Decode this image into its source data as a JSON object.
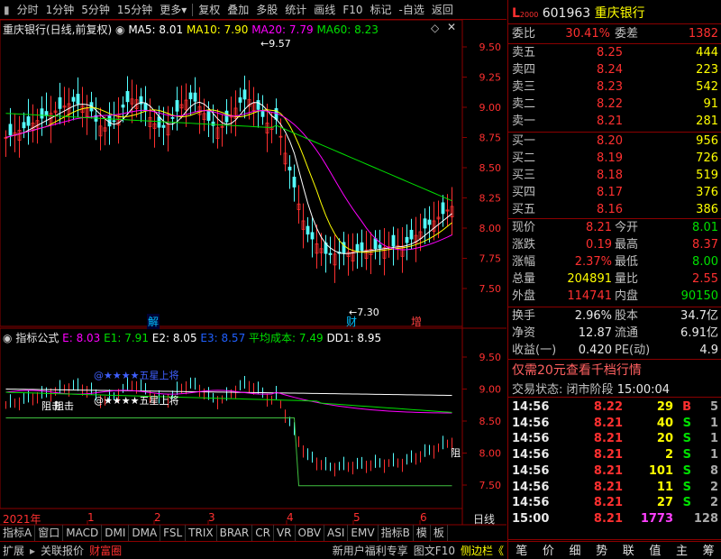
{
  "toolbar": {
    "period_items": [
      "分时",
      "1分钟",
      "5分钟",
      "15分钟",
      "更多"
    ],
    "items": [
      "复权",
      "叠加",
      "多股",
      "统计",
      "画线",
      "F10",
      "标记",
      "-自选",
      "返回"
    ]
  },
  "main_chart": {
    "title": "重庆银行(日线,前复权)",
    "ma5_label": "MA5: 8.01",
    "ma10_label": "MA10: 7.90",
    "ma20_label": "MA20: 7.79",
    "ma60_label": "MA60: 8.23",
    "high_annot": "9.57",
    "low_annot": "7.30",
    "y_ticks": [
      "9.50",
      "9.25",
      "9.00",
      "8.75",
      "8.50",
      "8.25",
      "8.00",
      "7.75",
      "7.50"
    ],
    "markers": [
      "解",
      "财",
      "增"
    ]
  },
  "indicator_chart": {
    "name": "指标公式",
    "e_label": "E: 8.03",
    "e1_label": "E1: 7.91",
    "e2_label": "E2: 8.05",
    "e3_label": "E3: 8.57",
    "avg_cost_label": "平均成本: 7.49",
    "dd1_label": "DD1: 8.95",
    "y_ticks": [
      "9.50",
      "9.00",
      "8.50",
      "8.00",
      "7.50"
    ],
    "annot_star1": "@★★★★五星上将",
    "annot_star2": "@★★★★五星上将",
    "annot_zuji1": "阻击",
    "annot_zuji2": "阻击",
    "annot_zu": "阻"
  },
  "x_axis": {
    "year": "2021年",
    "months": [
      "1",
      "2",
      "3",
      "4",
      "5",
      "6"
    ],
    "day_label": "日线"
  },
  "tabs": [
    "指标A",
    "窗口",
    "MACD",
    "DMI",
    "DMA",
    "FSL",
    "TRIX",
    "BRAR",
    "CR",
    "VR",
    "OBV",
    "ASI",
    "EMV",
    "指标B",
    "模",
    "板"
  ],
  "bottom": {
    "items": [
      "扩展",
      "关联报价",
      "财富圈"
    ],
    "promo": "新用户福利专享",
    "f10": "图文F10",
    "side": "侧边栏《"
  },
  "quote": {
    "level": "L",
    "code": "601963",
    "name": "重庆银行",
    "wei_bi_label": "委比",
    "wei_bi": "30.41%",
    "wei_cha_label": "委差",
    "wei_cha": "1382",
    "asks": [
      {
        "label": "卖五",
        "price": "8.25",
        "vol": "444"
      },
      {
        "label": "卖四",
        "price": "8.24",
        "vol": "223"
      },
      {
        "label": "卖三",
        "price": "8.23",
        "vol": "542"
      },
      {
        "label": "卖二",
        "price": "8.22",
        "vol": "91"
      },
      {
        "label": "卖一",
        "price": "8.21",
        "vol": "281"
      }
    ],
    "bids": [
      {
        "label": "买一",
        "price": "8.20",
        "vol": "956"
      },
      {
        "label": "买二",
        "price": "8.19",
        "vol": "726"
      },
      {
        "label": "买三",
        "price": "8.18",
        "vol": "519"
      },
      {
        "label": "买四",
        "price": "8.17",
        "vol": "376"
      },
      {
        "label": "买五",
        "price": "8.16",
        "vol": "386"
      }
    ],
    "stats": [
      {
        "l1": "现价",
        "v1": "8.21",
        "c1": "red",
        "l2": "今开",
        "v2": "8.01",
        "c2": "grn"
      },
      {
        "l1": "涨跌",
        "v1": "0.19",
        "c1": "red",
        "l2": "最高",
        "v2": "8.37",
        "c2": "red"
      },
      {
        "l1": "涨幅",
        "v1": "2.37%",
        "c1": "red",
        "l2": "最低",
        "v2": "8.00",
        "c2": "grn"
      },
      {
        "l1": "总量",
        "v1": "204891",
        "c1": "yel",
        "l2": "量比",
        "v2": "2.55",
        "c2": "red"
      },
      {
        "l1": "外盘",
        "v1": "114741",
        "c1": "red",
        "l2": "内盘",
        "v2": "90150",
        "c2": "grn"
      }
    ],
    "stats2": [
      {
        "l1": "换手",
        "v1": "2.96%",
        "l2": "股本",
        "v2": "34.7亿"
      },
      {
        "l1": "净资",
        "v1": "12.87",
        "l2": "流通",
        "v2": "6.91亿"
      },
      {
        "l1": "收益(一)",
        "v1": "0.420",
        "l2": "PE(动)",
        "v2": "4.9"
      }
    ],
    "promo": "仅需20元查看千档行情",
    "trade_status_label": "交易状态:",
    "trade_status": "闭市阶段",
    "trade_time": "15:00:04"
  },
  "ticks": [
    {
      "time": "14:56",
      "price": "8.22",
      "vol": "29",
      "bs": "B",
      "n": "5",
      "c": "red"
    },
    {
      "time": "14:56",
      "price": "8.21",
      "vol": "40",
      "bs": "S",
      "n": "1",
      "c": "grn"
    },
    {
      "time": "14:56",
      "price": "8.21",
      "vol": "20",
      "bs": "S",
      "n": "1",
      "c": "grn"
    },
    {
      "time": "14:56",
      "price": "8.21",
      "vol": "2",
      "bs": "S",
      "n": "1",
      "c": "grn"
    },
    {
      "time": "14:56",
      "price": "8.21",
      "vol": "101",
      "bs": "S",
      "n": "8",
      "c": "grn"
    },
    {
      "time": "14:56",
      "price": "8.21",
      "vol": "11",
      "bs": "S",
      "n": "2",
      "c": "grn"
    },
    {
      "time": "14:56",
      "price": "8.21",
      "vol": "27",
      "bs": "S",
      "n": "2",
      "c": "grn"
    },
    {
      "time": "15:00",
      "price": "8.21",
      "vol": "1773",
      "bs": "",
      "n": "128",
      "c": "grn"
    }
  ],
  "right_bottom_buttons": [
    "笔",
    "价",
    "细",
    "势",
    "联",
    "值",
    "主",
    "筹"
  ]
}
